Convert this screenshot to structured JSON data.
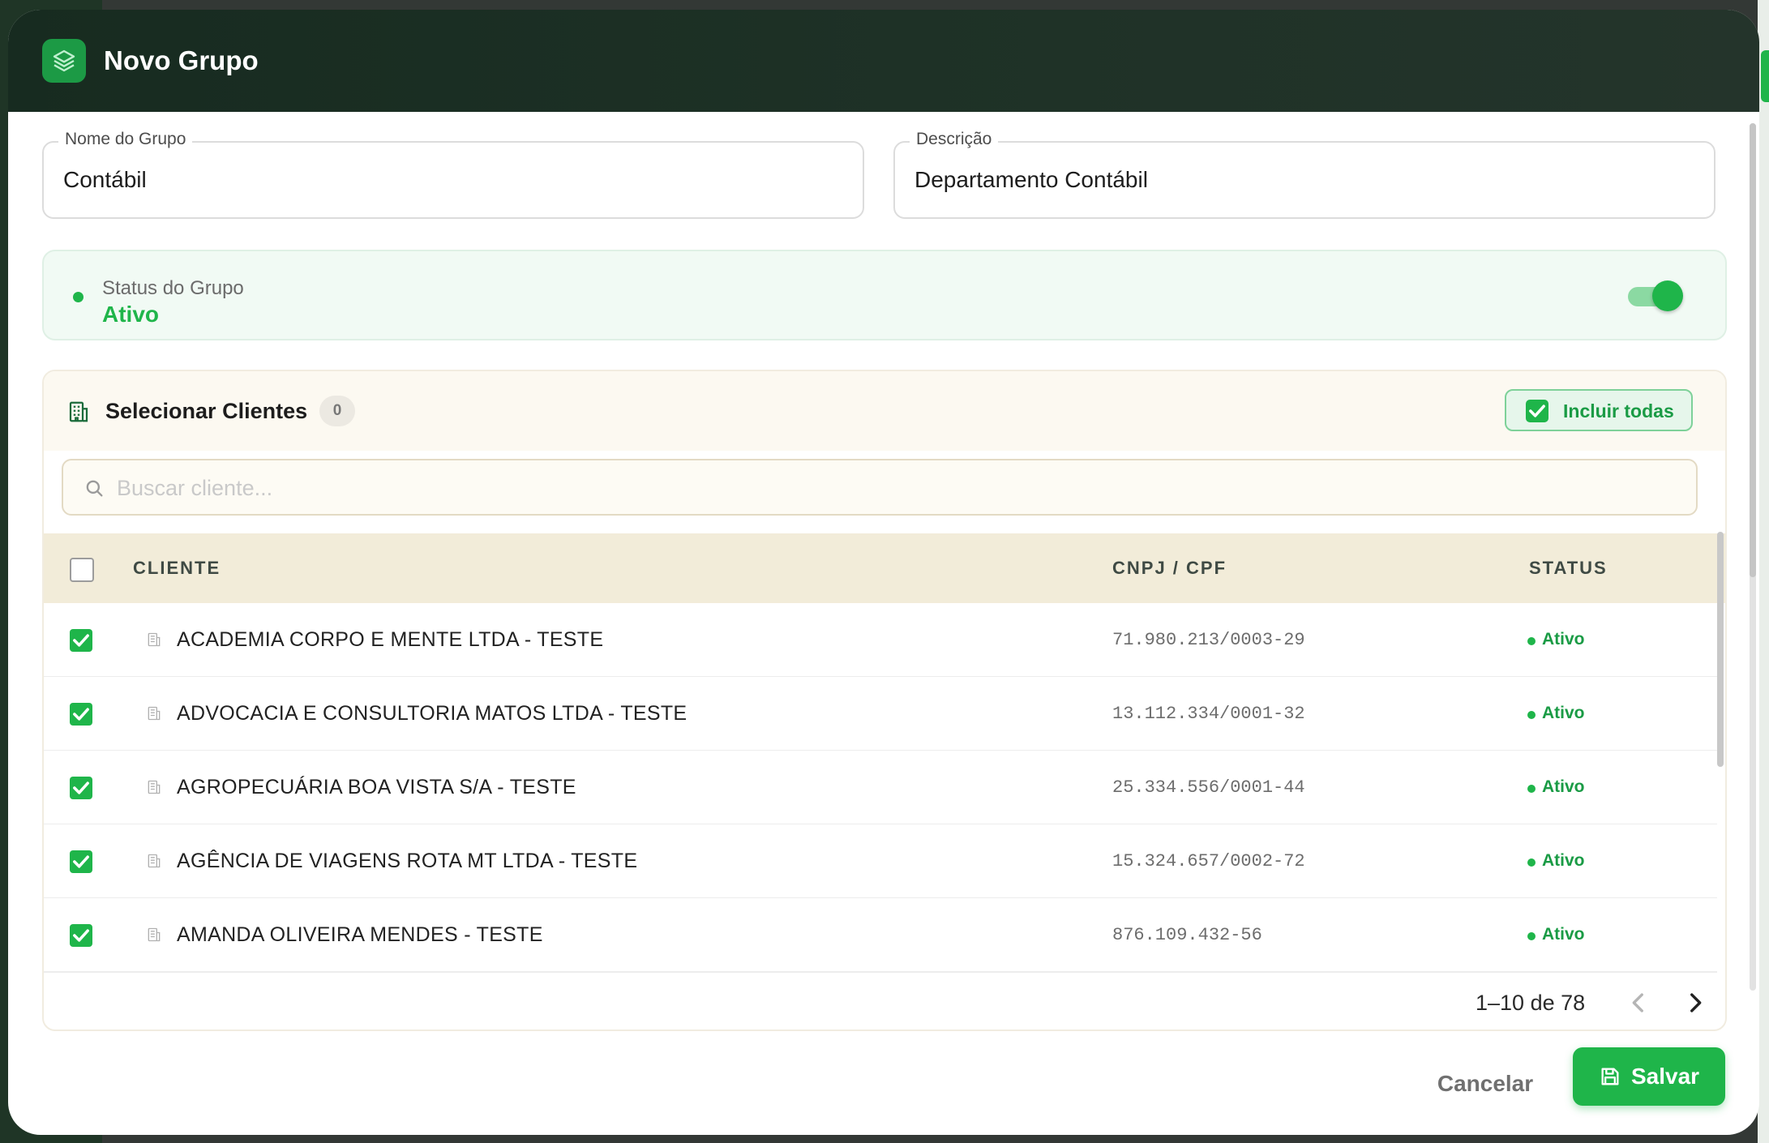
{
  "dialog": {
    "title": "Novo Grupo",
    "logo_icon": "layers-icon"
  },
  "form": {
    "name_label": "Nome do Grupo",
    "name_value": "Contábil",
    "description_label": "Descrição",
    "description_value": "Departamento Contábil"
  },
  "status": {
    "label": "Status do Grupo",
    "value": "Ativo",
    "enabled": true
  },
  "clients": {
    "title": "Selecionar Clientes",
    "selected_count": "0",
    "include_all_label": "Incluir todas",
    "include_all_checked": true,
    "search_placeholder": "Buscar cliente...",
    "columns": [
      "CLIENTE",
      "CNPJ / CPF",
      "STATUS"
    ],
    "rows": [
      {
        "name": "ACADEMIA CORPO E MENTE LTDA - TESTE",
        "doc": "71.980.213/0003-29",
        "status": "Ativo",
        "checked": true
      },
      {
        "name": "ADVOCACIA E CONSULTORIA MATOS LTDA - TESTE",
        "doc": "13.112.334/0001-32",
        "status": "Ativo",
        "checked": true
      },
      {
        "name": "AGROPECUÁRIA BOA VISTA S/A - TESTE",
        "doc": "25.334.556/0001-44",
        "status": "Ativo",
        "checked": true
      },
      {
        "name": "AGÊNCIA DE VIAGENS ROTA MT LTDA - TESTE",
        "doc": "15.324.657/0002-72",
        "status": "Ativo",
        "checked": true
      },
      {
        "name": "AMANDA OLIVEIRA MENDES - TESTE",
        "doc": "876.109.432-56",
        "status": "Ativo",
        "checked": true
      }
    ],
    "pagination": "1–10 de 78"
  },
  "footer": {
    "cancel_label": "Cancelar",
    "save_label": "Salvar"
  },
  "colors": {
    "accent": "#1fb54a",
    "header_bg": "#1a2e23",
    "table_header_bg": "#f2ecd9"
  }
}
